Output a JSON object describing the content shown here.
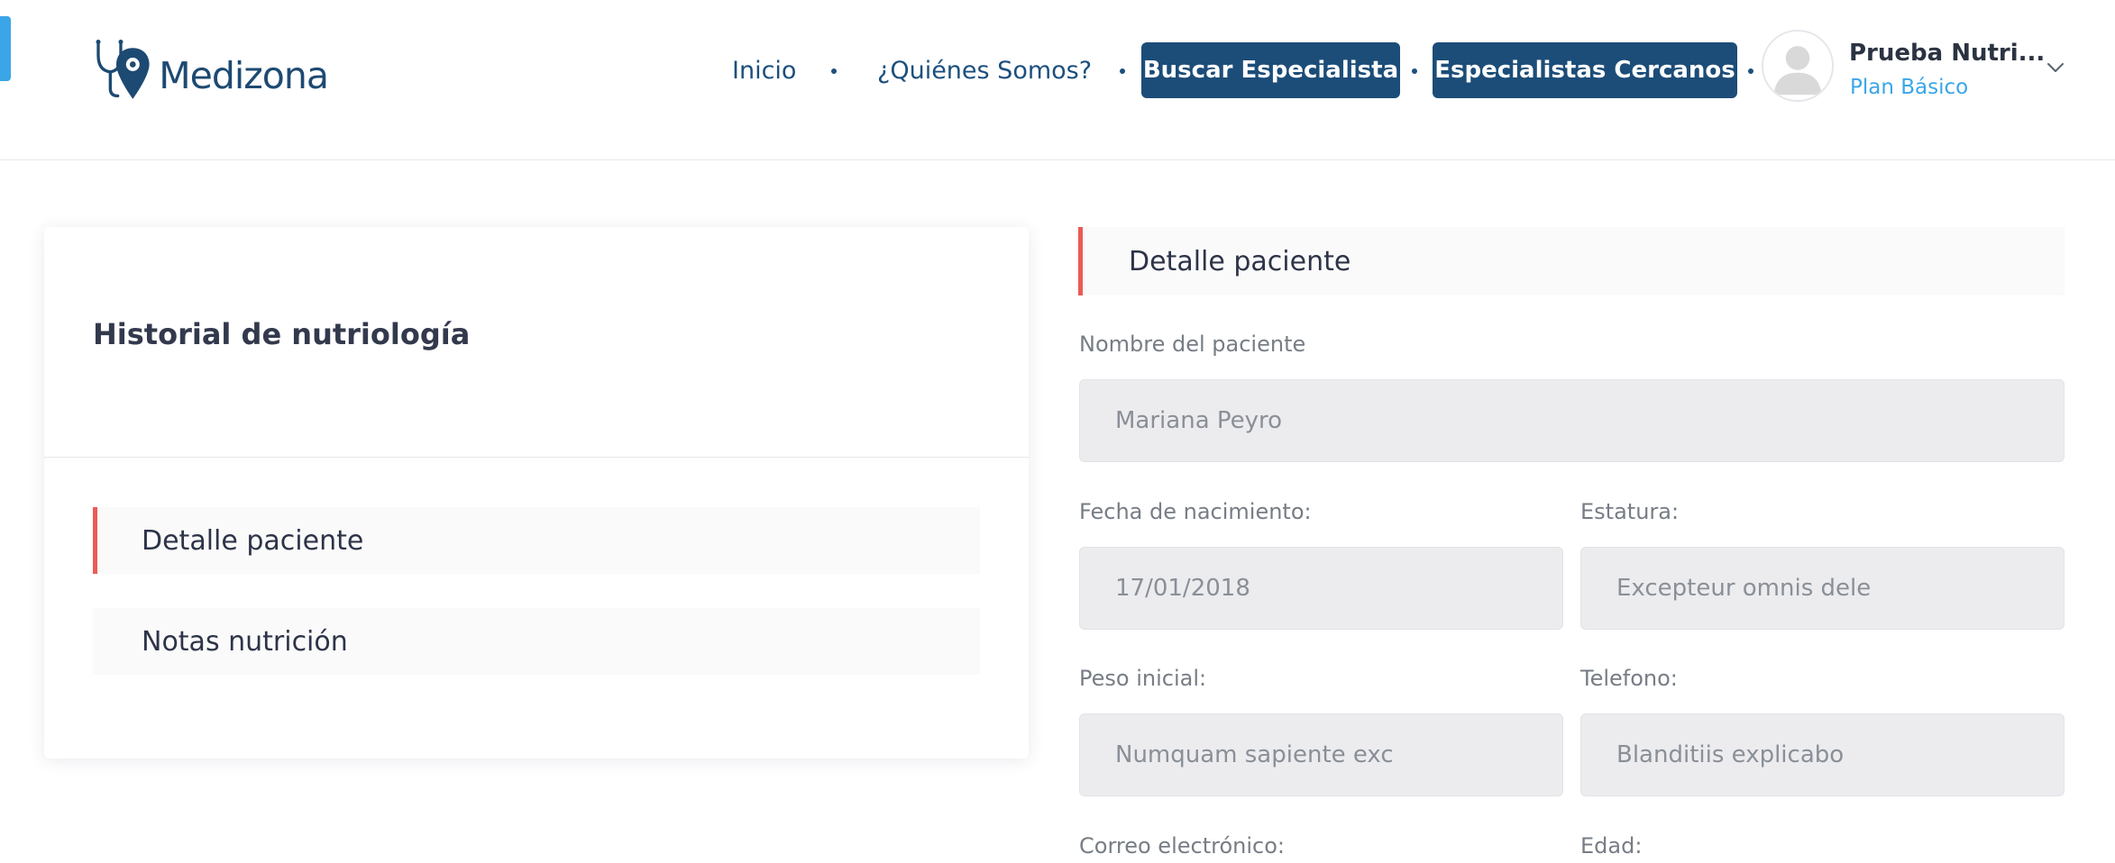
{
  "brand": {
    "name": "Medizona",
    "colors": {
      "primary": "#1c4d78",
      "accent": "#3aa6e8",
      "active_marker": "#ec5a55"
    }
  },
  "header": {
    "nav": {
      "inicio": "Inicio",
      "quienes_somos": "¿Quiénes Somos?",
      "buscar_especialista": "Buscar Especialista",
      "especialistas_cercanos": "Especialistas Cercanos"
    },
    "user": {
      "name": "Prueba Nutri...",
      "plan": "Plan Básico",
      "avatar_icon": "user-avatar-icon",
      "menu_icon": "chevron-down-icon"
    }
  },
  "sidebar": {
    "title": "Historial de nutriología",
    "items": [
      {
        "label": "Detalle paciente",
        "active": true
      },
      {
        "label": "Notas nutrición",
        "active": false
      }
    ]
  },
  "form": {
    "section_title": "Detalle paciente",
    "fields": {
      "nombre": {
        "label": "Nombre del paciente",
        "value": "Mariana Peyro"
      },
      "fecha_nacimiento": {
        "label": "Fecha de nacimiento:",
        "value": "17/01/2018"
      },
      "estatura": {
        "label": "Estatura:",
        "value": "Excepteur omnis dele"
      },
      "peso_inicial": {
        "label": "Peso inicial:",
        "value": "Numquam sapiente exc"
      },
      "telefono": {
        "label": "Telefono:",
        "value": "Blanditiis explicabo"
      },
      "correo": {
        "label": "Correo electrónico:"
      },
      "edad": {
        "label": "Edad:"
      }
    }
  }
}
